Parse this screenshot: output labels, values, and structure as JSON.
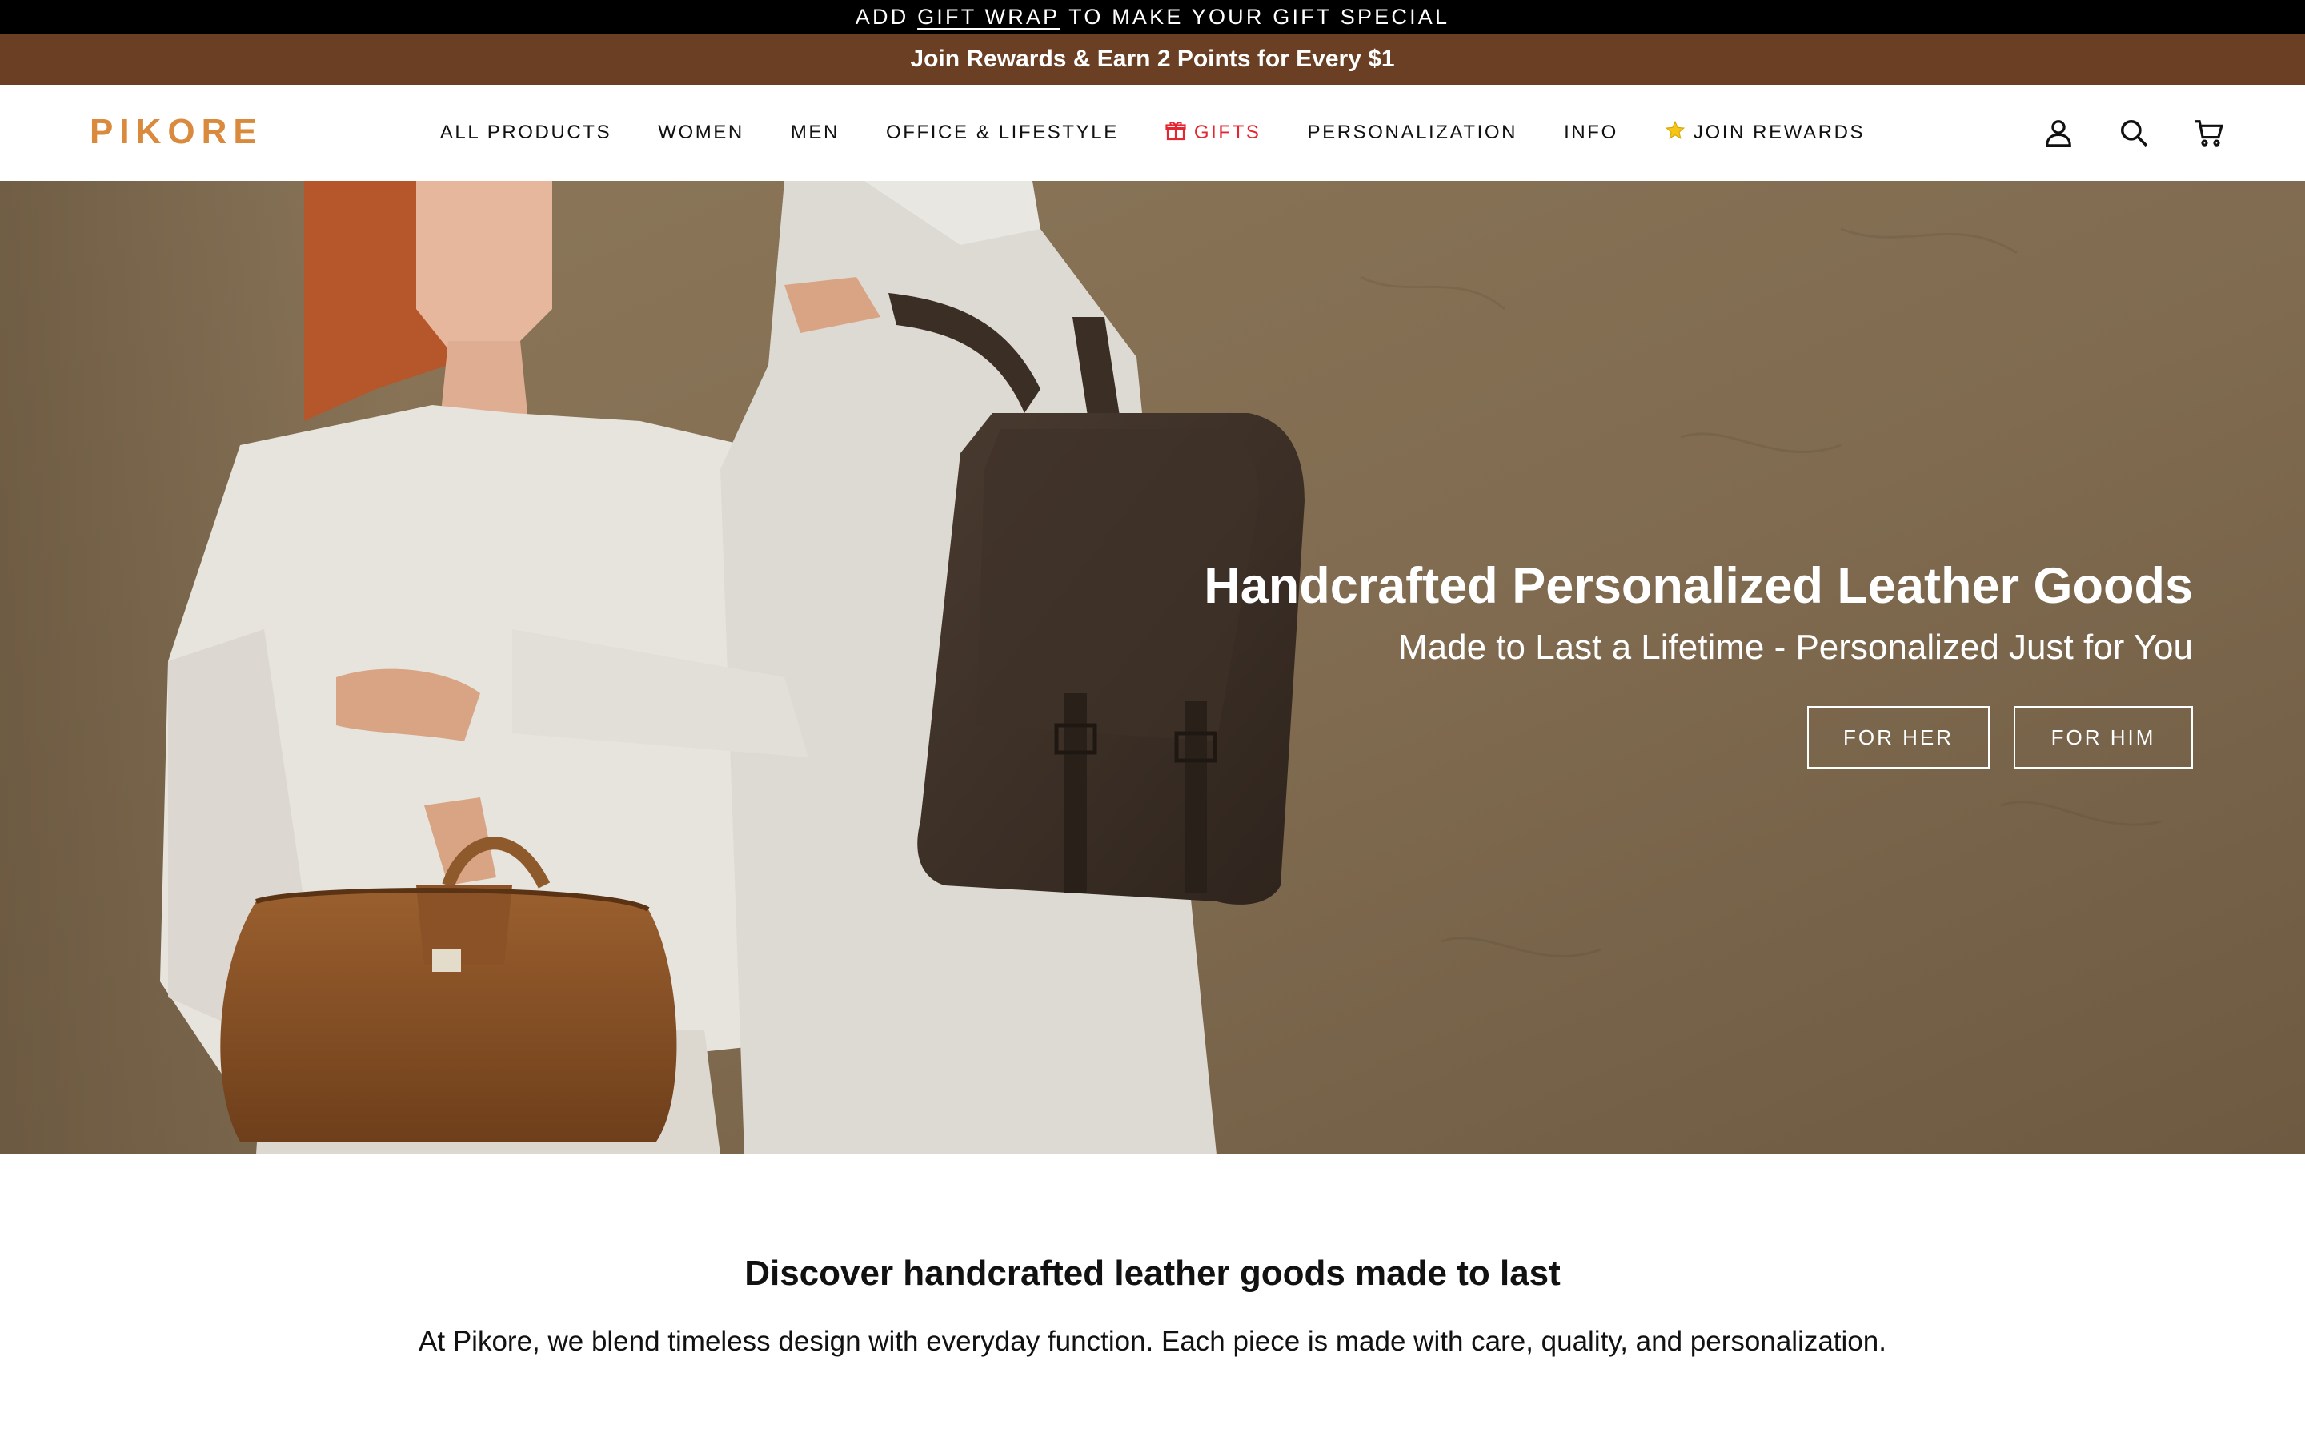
{
  "announcement": {
    "prefix": "ADD",
    "link": "GIFT WRAP",
    "suffix": "TO MAKE YOUR GIFT SPECIAL"
  },
  "rewards_bar": {
    "text": "Join Rewards & Earn 2 Points for Every $1"
  },
  "header": {
    "logo": "PIKORE",
    "nav": [
      {
        "label": "ALL PRODUCTS"
      },
      {
        "label": "WOMEN"
      },
      {
        "label": "MEN"
      },
      {
        "label": "OFFICE & LIFESTYLE"
      },
      {
        "label": "GIFTS",
        "icon": "gift-icon",
        "color": "#e3262f"
      },
      {
        "label": "PERSONALIZATION"
      },
      {
        "label": "INFO"
      },
      {
        "label": "JOIN REWARDS",
        "icon": "star-icon"
      }
    ],
    "icons": [
      "account-icon",
      "search-icon",
      "cart-icon"
    ]
  },
  "hero": {
    "title": "Handcrafted Personalized Leather Goods",
    "subtitle": "Made to Last a Lifetime - Personalized Just for You",
    "buttons": {
      "her": "FOR HER",
      "him": "FOR HIM"
    }
  },
  "intro": {
    "title": "Discover handcrafted leather goods made to last",
    "body": "At Pikore, we blend timeless design with everyday function. Each piece is made with care, quality, and personalization."
  },
  "colors": {
    "announce_bg": "#000000",
    "rewards_bg": "#6a3f24",
    "logo": "#d98a3d",
    "gifts_accent": "#e3262f"
  }
}
